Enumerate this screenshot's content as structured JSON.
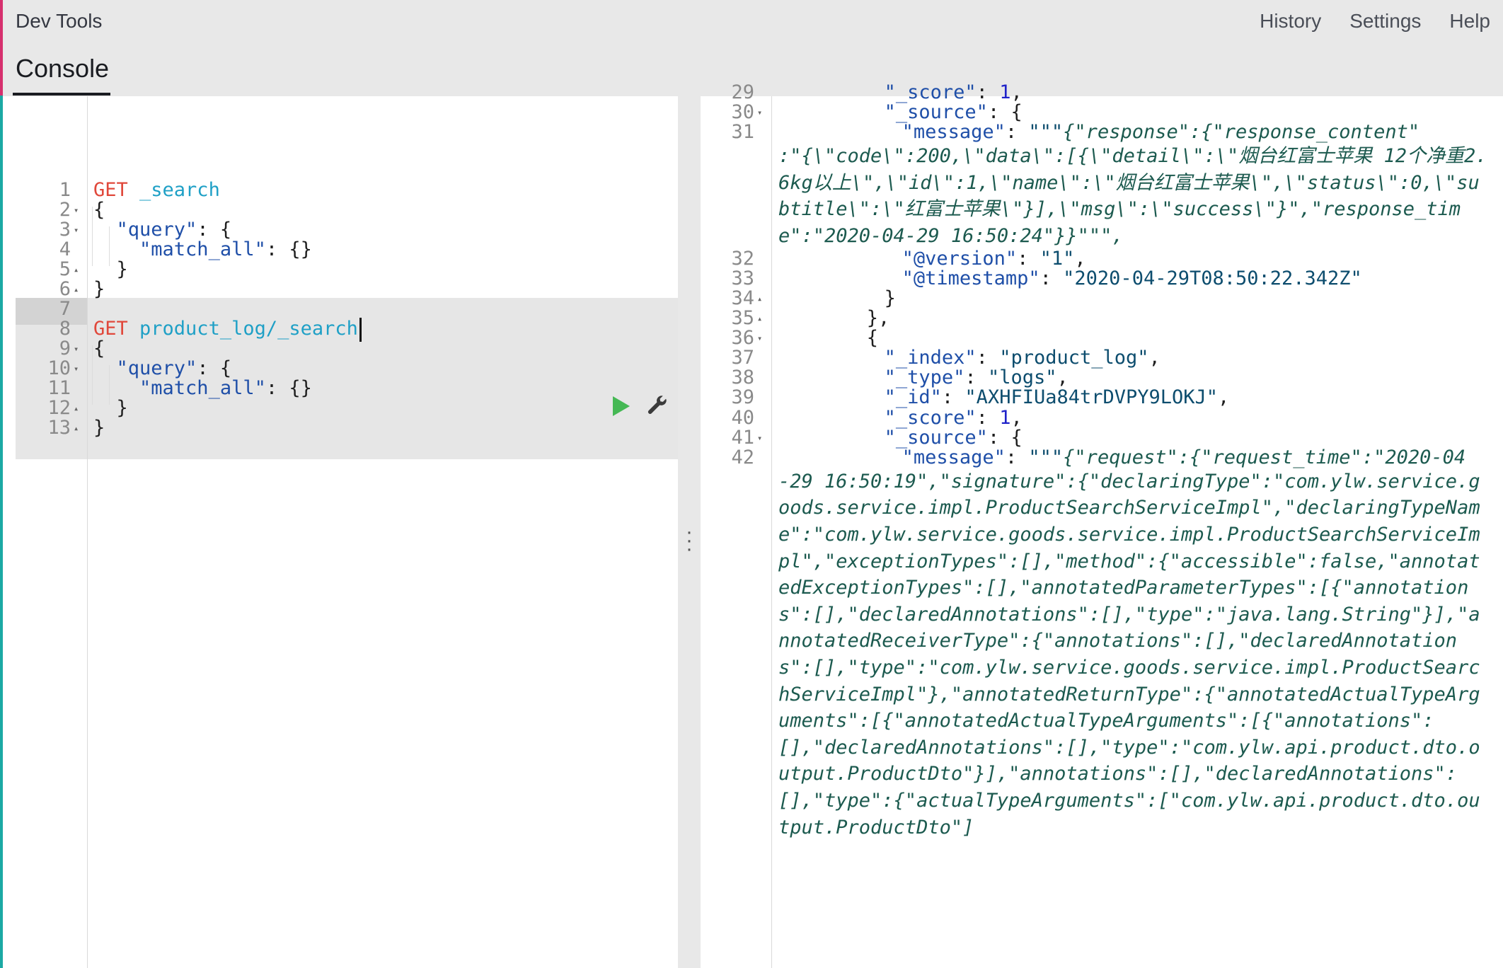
{
  "header": {
    "title": "Dev Tools",
    "links": [
      "History",
      "Settings",
      "Help"
    ]
  },
  "tabs": [
    "Console"
  ],
  "left_editor": {
    "lines": [
      {
        "n": "1",
        "fold": "",
        "parts": [
          [
            "kw-method",
            "GET "
          ],
          [
            "kw-path",
            "_search"
          ]
        ]
      },
      {
        "n": "2",
        "fold": "▾",
        "parts": [
          [
            "",
            "{"
          ]
        ]
      },
      {
        "n": "3",
        "fold": "▾",
        "parts": [
          [
            "",
            "  "
          ],
          [
            "kw-key",
            "\"query\""
          ],
          [
            "",
            ": {"
          ]
        ]
      },
      {
        "n": "4",
        "fold": "",
        "parts": [
          [
            "",
            "    "
          ],
          [
            "kw-key",
            "\"match_all\""
          ],
          [
            "",
            ": {}"
          ]
        ]
      },
      {
        "n": "5",
        "fold": "▴",
        "parts": [
          [
            "",
            "  }"
          ]
        ]
      },
      {
        "n": "6",
        "fold": "▴",
        "parts": [
          [
            "",
            "}"
          ]
        ]
      },
      {
        "n": "7",
        "fold": "",
        "parts": [
          [
            "",
            ""
          ]
        ]
      },
      {
        "n": "8",
        "fold": "",
        "parts": [
          [
            "kw-method",
            "GET "
          ],
          [
            "kw-path",
            "product_log/_search"
          ]
        ]
      },
      {
        "n": "9",
        "fold": "▾",
        "parts": [
          [
            "",
            "{"
          ]
        ]
      },
      {
        "n": "10",
        "fold": "▾",
        "parts": [
          [
            "",
            "  "
          ],
          [
            "kw-key",
            "\"query\""
          ],
          [
            "",
            ": {"
          ]
        ]
      },
      {
        "n": "11",
        "fold": "",
        "parts": [
          [
            "",
            "    "
          ],
          [
            "kw-key",
            "\"match_all\""
          ],
          [
            "",
            ": {}"
          ]
        ]
      },
      {
        "n": "12",
        "fold": "▴",
        "parts": [
          [
            "",
            "  }"
          ]
        ]
      },
      {
        "n": "13",
        "fold": "▴",
        "parts": [
          [
            "",
            "}"
          ]
        ]
      }
    ]
  },
  "right_editor": {
    "lines": [
      {
        "n": "29",
        "fold": "",
        "indent": 6,
        "parts": [
          [
            "kw-key",
            "\"_score\""
          ],
          [
            "",
            ": "
          ],
          [
            "kw-num",
            "1"
          ],
          [
            "",
            ","
          ]
        ]
      },
      {
        "n": "30",
        "fold": "▾",
        "indent": 6,
        "parts": [
          [
            "kw-key",
            "\"_source\""
          ],
          [
            "",
            ": {"
          ]
        ]
      },
      {
        "n": "31",
        "fold": "",
        "indent": 7,
        "parts": [
          [
            "kw-key",
            "\"message\""
          ],
          [
            "",
            ": "
          ],
          [
            "kw-str",
            "\"\"\""
          ],
          [
            "kw-italic",
            "{\"response\":{\"response_content\""
          ]
        ]
      },
      {
        "n": "",
        "fold": "",
        "wrap": ":\"{\\\"code\\\":200,\\\"data\\\":[{\\\"detail\\\":\\\"烟台红富士苹果 12个净重2.6kg以上\\\",\\\"id\\\":1,\\\"name\\\":\\\"烟台红富士苹果\\\",\\\"status\\\":0,\\\"subtitle\\\":\\\"红富士苹果\\\"}],\\\"msg\\\":\\\"success\\\"}\",\"response_time\":\"2020-04-29 16:50:24\"}}\"\"\","
      },
      {
        "n": "32",
        "fold": "",
        "indent": 7,
        "parts": [
          [
            "kw-key",
            "\"@version\""
          ],
          [
            "",
            ": "
          ],
          [
            "kw-str",
            "\"1\""
          ],
          [
            "",
            ","
          ]
        ]
      },
      {
        "n": "33",
        "fold": "",
        "indent": 7,
        "parts": [
          [
            "kw-key",
            "\"@timestamp\""
          ],
          [
            "",
            ": "
          ],
          [
            "kw-str",
            "\"2020-04-29T08:50:22.342Z\""
          ]
        ]
      },
      {
        "n": "34",
        "fold": "▴",
        "indent": 6,
        "parts": [
          [
            "",
            "}"
          ]
        ]
      },
      {
        "n": "35",
        "fold": "▴",
        "indent": 5,
        "parts": [
          [
            "",
            "},"
          ]
        ]
      },
      {
        "n": "36",
        "fold": "▾",
        "indent": 5,
        "parts": [
          [
            "",
            "{"
          ]
        ]
      },
      {
        "n": "37",
        "fold": "",
        "indent": 6,
        "parts": [
          [
            "kw-key",
            "\"_index\""
          ],
          [
            "",
            ": "
          ],
          [
            "kw-str",
            "\"product_log\""
          ],
          [
            "",
            ","
          ]
        ]
      },
      {
        "n": "38",
        "fold": "",
        "indent": 6,
        "parts": [
          [
            "kw-key",
            "\"_type\""
          ],
          [
            "",
            ": "
          ],
          [
            "kw-str",
            "\"logs\""
          ],
          [
            "",
            ","
          ]
        ]
      },
      {
        "n": "39",
        "fold": "",
        "indent": 6,
        "parts": [
          [
            "kw-key",
            "\"_id\""
          ],
          [
            "",
            ": "
          ],
          [
            "kw-str",
            "\"AXHFIUa84trDVPY9LOKJ\""
          ],
          [
            "",
            ","
          ]
        ]
      },
      {
        "n": "40",
        "fold": "",
        "indent": 6,
        "parts": [
          [
            "kw-key",
            "\"_score\""
          ],
          [
            "",
            ": "
          ],
          [
            "kw-num",
            "1"
          ],
          [
            "",
            ","
          ]
        ]
      },
      {
        "n": "41",
        "fold": "▾",
        "indent": 6,
        "parts": [
          [
            "kw-key",
            "\"_source\""
          ],
          [
            "",
            ": {"
          ]
        ]
      },
      {
        "n": "42",
        "fold": "",
        "indent": 7,
        "parts": [
          [
            "kw-key",
            "\"message\""
          ],
          [
            "",
            ": "
          ],
          [
            "kw-str",
            "\"\"\""
          ],
          [
            "kw-italic",
            "{\"request\":{\"request_time\":\"2020-04"
          ]
        ]
      },
      {
        "n": "",
        "fold": "",
        "wrap": "-29 16:50:19\",\"signature\":{\"declaringType\":\"com.ylw.service.goods.service.impl.ProductSearchServiceImpl\",\"declaringTypeName\":\"com.ylw.service.goods.service.impl.ProductSearchServiceImpl\",\"exceptionTypes\":[],\"method\":{\"accessible\":false,\"annotatedExceptionTypes\":[],\"annotatedParameterTypes\":[{\"annotations\":[],\"declaredAnnotations\":[],\"type\":\"java.lang.String\"}],\"annotatedReceiverType\":{\"annotations\":[],\"declaredAnnotations\":[],\"type\":\"com.ylw.service.goods.service.impl.ProductSearchServiceImpl\"},\"annotatedReturnType\":{\"annotatedActualTypeArguments\":[{\"annotatedActualTypeArguments\":[{\"annotations\":[],\"declaredAnnotations\":[],\"type\":\"com.ylw.api.product.dto.output.ProductDto\"}],\"annotations\":[],\"declaredAnnotations\":[],\"type\":{\"actualTypeArguments\":[\"com.ylw.api.product.dto.output.ProductDto\"]"
      }
    ]
  },
  "icons": {
    "run": "play-icon",
    "settings": "wrench-icon",
    "resize": "vertical-dots-icon"
  },
  "colors": {
    "accent": "#d6306e",
    "accent2": "#1ba9a4",
    "method": "#e0483b",
    "path": "#1fa0c6",
    "key": "#1f4fa8",
    "run": "#45b854"
  }
}
